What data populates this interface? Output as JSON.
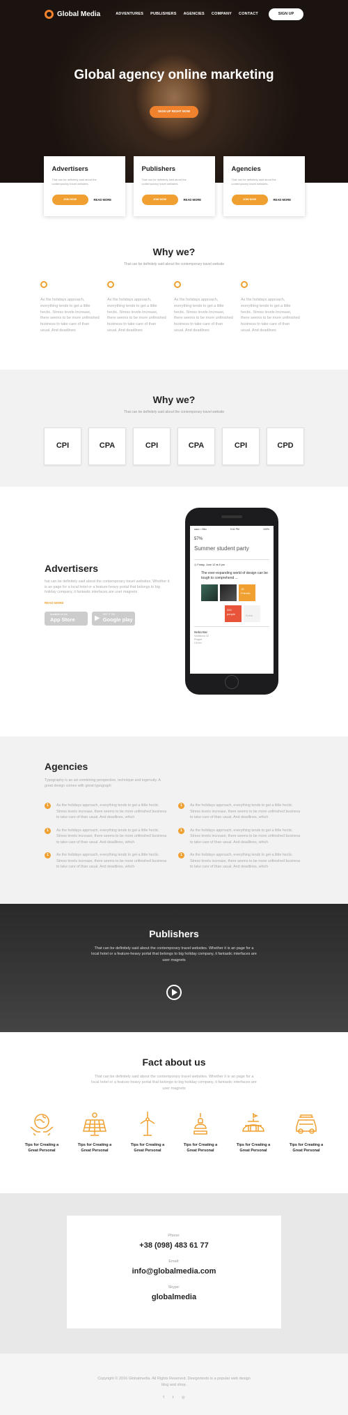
{
  "nav": {
    "brand": "Global Media",
    "links": [
      "ADVENTURES",
      "PUBLISHERS",
      "AGENCIES",
      "COMPANY",
      "CONTACT"
    ],
    "signup": "SIGN UP"
  },
  "hero": {
    "title": "Global agency online marketing",
    "cta": "SIGN UP RIGHT NOW"
  },
  "cards": [
    {
      "title": "Advertisers",
      "text": "That can be definitely said about the contemporary travel websites.",
      "join": "JOIN NOW",
      "more": "READ MORE"
    },
    {
      "title": "Publishers",
      "text": "That can be definitely said about the contemporary travel websites.",
      "join": "JOIN NOW",
      "more": "READ MORE"
    },
    {
      "title": "Agencies",
      "text": "That can be definitely said about the contemporary travel websites.",
      "join": "JOIN NOW",
      "more": "READ MORE"
    }
  ],
  "why1": {
    "title": "Why we?",
    "subtitle": "That can be definitely said about the contemporary travel website",
    "items": [
      "As the holidays approach, everything tends to get a little hectic. Stress levels increase, there seems to be more unfinished business to take care of than usual. And deadlines",
      "As the holidays approach, everything tends to get a little hectic. Stress levels increase, there seems to be more unfinished business to take care of than usual. And deadlines",
      "As the holidays approach, everything tends to get a little hectic. Stress levels increase, there seems to be more unfinished business to take care of than usual. And deadlines",
      "As the holidays approach, everything tends to get a little hectic. Stress levels increase, there seems to be more unfinished business to take care of than usual. And deadlines"
    ]
  },
  "why2": {
    "title": "Why we?",
    "subtitle": "That can be definitely said about the contemporary travel website",
    "tiles": [
      "CPI",
      "CPA",
      "CPI",
      "CPA",
      "CPI",
      "CPD"
    ]
  },
  "advertisers": {
    "title": "Advertisers",
    "text": "hat can be definitely said about the contemporary travel websites. Whether it is an page for a local hotel or a feature-heavy portal that belongs to big holiday company, it fantastic interfaces are user magnets",
    "link": "READ MORE",
    "appstore_small": "Available on the",
    "appstore_big": "App Store",
    "gplay_small": "GET IT ON",
    "gplay_big": "Google play"
  },
  "phone": {
    "carrier": "●●●○○ Bitu",
    "time": "9:41 PM",
    "battery": "100%",
    "percent": "57%",
    "event_title": "Summer student party",
    "date": "Friday, June 12 at 8 pm",
    "note": "The ever-expanding world of design can be tough to comprehend ...",
    "badge1_num": "18",
    "badge1_txt": "Friends",
    "badge2_num": "200",
    "badge2_txt": "people",
    "badge3_txt": "Event",
    "venue": "Neba Bar",
    "venue_addr": "Vodičkova 32",
    "venue_city": "Prague",
    "venue_dist": "0.8 km"
  },
  "agencies": {
    "title": "Agencies",
    "intro": "Typography is an art combining perspective, technique and ingenuity. A great design comes with great typograph",
    "items": [
      {
        "n": "1",
        "text": "As the holidays approach, everything tends to get a little hectic. Stress levels increase, there seems to be more unfinished business to take care of than usual. And deadlines, which"
      },
      {
        "n": "1",
        "text": "As the holidays approach, everything tends to get a little hectic. Stress levels increase, there seems to be more unfinished business to take care of than usual. And deadlines, which"
      },
      {
        "n": "1",
        "text": "As the holidays approach, everything tends to get a little hectic. Stress levels increase, there seems to be more unfinished business to take care of than usual. And deadlines, which"
      },
      {
        "n": "1",
        "text": "As the holidays approach, everything tends to get a little hectic. Stress levels increase, there seems to be more unfinished business to take care of than usual. And deadlines, which"
      },
      {
        "n": "1",
        "text": "As the holidays approach, everything tends to get a little hectic. Stress levels increase, there seems to be more unfinished business to take care of than usual. And deadlines, which"
      },
      {
        "n": "1",
        "text": "As the holidays approach, everything tends to get a little hectic. Stress levels increase, there seems to be more unfinished business to take care of than usual. And deadlines, which"
      }
    ]
  },
  "publishers": {
    "title": "Publishers",
    "text": "That can be definitely said about the contemporary travel websites. Whether it is an page for a local hotel or a feature-heavy portal that belongs to big holiday company, it fantastic interfaces are user magnets"
  },
  "facts": {
    "title": "Fact about us",
    "text": "That can be definitely said about the contemporary travel websites. Whether it is an page for a local hotel or a feature-heavy portal that belongs to big holiday company, it fantastic interfaces are user magnets",
    "items": [
      {
        "icon": "globe-hands-icon",
        "caption": "Tips for Creating a Great Personal"
      },
      {
        "icon": "solar-panel-icon",
        "caption": "Tips for Creating a Great Personal"
      },
      {
        "icon": "wind-turbine-icon",
        "caption": "Tips for Creating a Great Personal"
      },
      {
        "icon": "lamp-icon",
        "caption": "Tips for Creating a Great Personal"
      },
      {
        "icon": "igloo-icon",
        "caption": "Tips for Creating a Great Personal"
      },
      {
        "icon": "car-icon",
        "caption": "Tips for Creating a Great Personal"
      }
    ]
  },
  "contact": {
    "phone_label": "Phone:",
    "phone": "+38 (098) 483 61 77",
    "email_label": "Email:",
    "email": "info@globalmedia.com",
    "skype_label": "Skype:",
    "skype": "globalmedia"
  },
  "footer": {
    "text": "Copyright © 2016 Globalmedia. All Rights Reserved. Designmodo is a popular web design blog and shop.",
    "social": [
      "f",
      "t",
      "◎"
    ]
  },
  "colors": {
    "accent": "#f0a030",
    "accent_dark": "#f0812d"
  }
}
